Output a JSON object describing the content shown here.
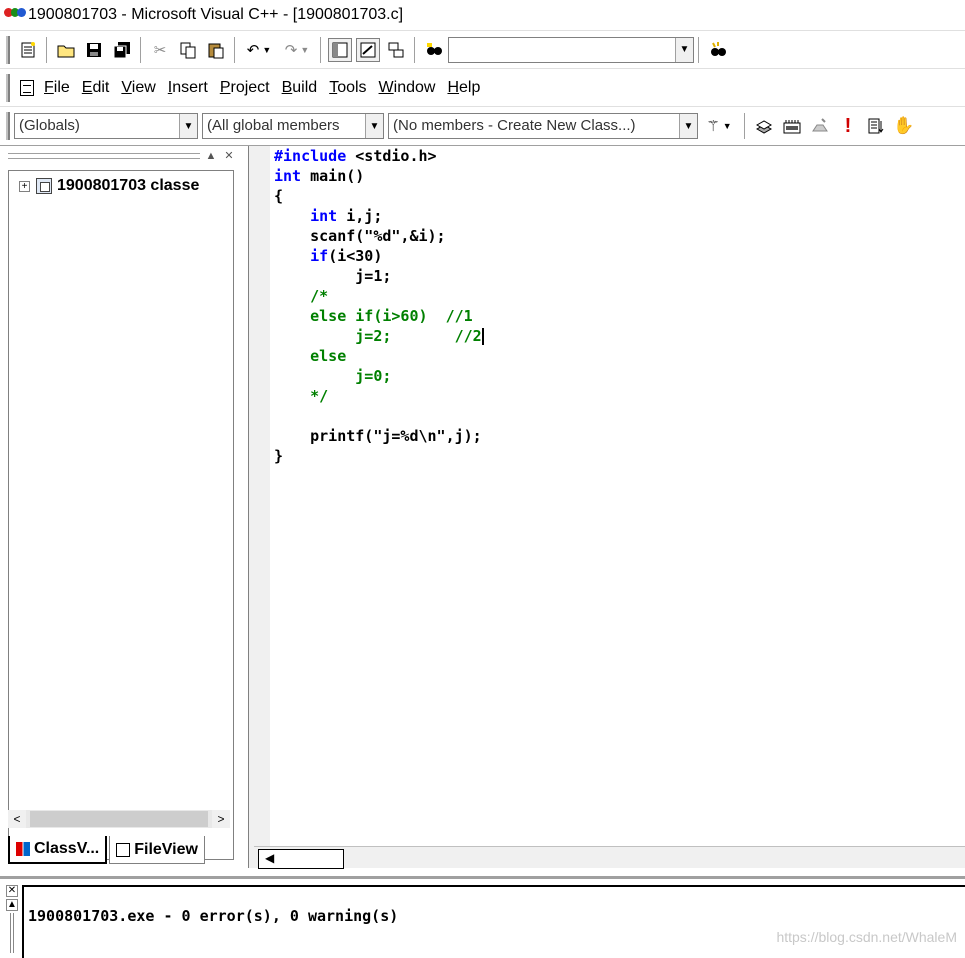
{
  "window": {
    "title": "1900801703 - Microsoft Visual C++ - [1900801703.c]"
  },
  "toolbar1": {
    "buttons": [
      "new-text-file",
      "open",
      "save",
      "save-all",
      "cut",
      "copy",
      "paste",
      "undo",
      "redo",
      "workspace",
      "output",
      "window-list",
      "find-in-files"
    ],
    "find_value": ""
  },
  "menubar": {
    "items": [
      {
        "label": "File",
        "key": "F",
        "rest": "ile"
      },
      {
        "label": "Edit",
        "key": "E",
        "rest": "dit"
      },
      {
        "label": "View",
        "key": "V",
        "rest": "iew"
      },
      {
        "label": "Insert",
        "key": "I",
        "rest": "nsert"
      },
      {
        "label": "Project",
        "key": "P",
        "rest": "roject"
      },
      {
        "label": "Build",
        "key": "B",
        "rest": "uild"
      },
      {
        "label": "Tools",
        "key": "T",
        "rest": "ools"
      },
      {
        "label": "Window",
        "key": "W",
        "rest": "indow"
      },
      {
        "label": "Help",
        "key": "H",
        "rest": "elp"
      }
    ]
  },
  "wizardbar": {
    "scope": "(Globals)",
    "members": "(All global members",
    "functions": "(No members - Create New Class...)"
  },
  "workspace": {
    "tree_root": "1900801703 classe",
    "tabs": [
      {
        "label": "ClassV..."
      },
      {
        "label": "FileView"
      }
    ]
  },
  "editor": {
    "lines": [
      [
        {
          "t": "#include",
          "c": "kw"
        },
        {
          "t": " <stdio.h>",
          "c": ""
        }
      ],
      [
        {
          "t": "int",
          "c": "kw"
        },
        {
          "t": " main()",
          "c": ""
        }
      ],
      [
        {
          "t": "{",
          "c": ""
        }
      ],
      [
        {
          "t": "    ",
          "c": ""
        },
        {
          "t": "int",
          "c": "kw"
        },
        {
          "t": " i,j;",
          "c": ""
        }
      ],
      [
        {
          "t": "    scanf(\"%d\",&i);",
          "c": ""
        }
      ],
      [
        {
          "t": "    ",
          "c": ""
        },
        {
          "t": "if",
          "c": "kw"
        },
        {
          "t": "(i<30)",
          "c": ""
        }
      ],
      [
        {
          "t": "         j=1;",
          "c": ""
        }
      ],
      [
        {
          "t": "    /*",
          "c": "cm"
        }
      ],
      [
        {
          "t": "    else if(i>60)  //1",
          "c": "cm"
        }
      ],
      [
        {
          "t": "         j=2;       //2",
          "c": "cm"
        },
        {
          "t": "",
          "c": "caret"
        }
      ],
      [
        {
          "t": "    else",
          "c": "cm"
        }
      ],
      [
        {
          "t": "         j=0;",
          "c": "cm"
        }
      ],
      [
        {
          "t": "    */",
          "c": "cm"
        }
      ],
      [
        {
          "t": "",
          "c": ""
        }
      ],
      [
        {
          "t": "    printf(\"j=%d\\n\",j);",
          "c": ""
        }
      ],
      [
        {
          "t": "}",
          "c": ""
        }
      ]
    ]
  },
  "output": {
    "text": "1900801703.exe - 0 error(s), 0 warning(s)"
  },
  "watermark": "https://blog.csdn.net/WhaleM"
}
